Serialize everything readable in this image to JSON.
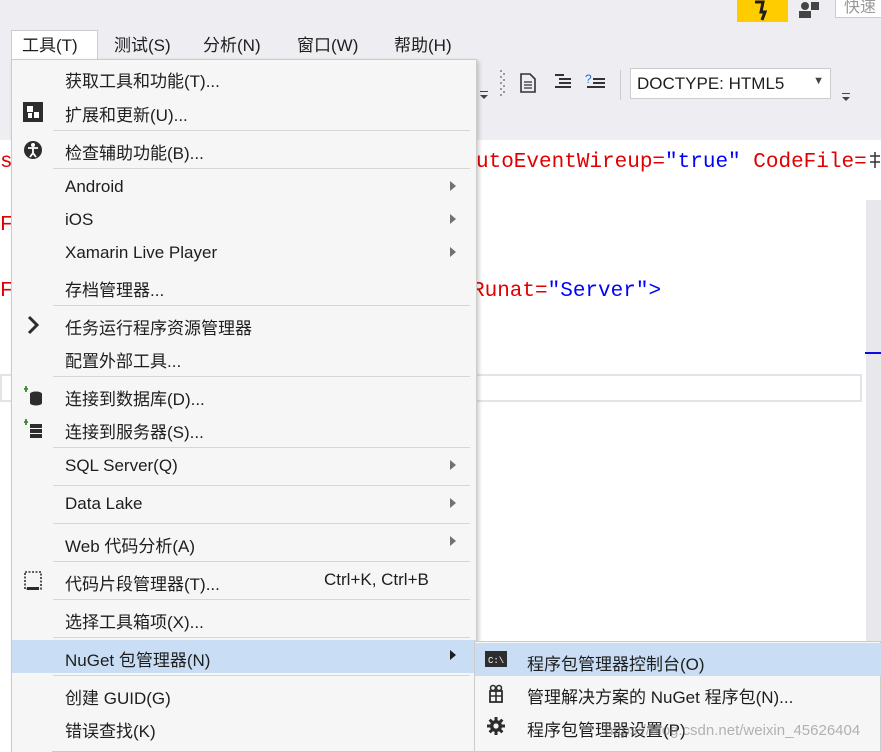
{
  "titlebar": {
    "quick_launch_placeholder": "快速"
  },
  "menubar": {
    "items": [
      {
        "label": "工具(T)"
      },
      {
        "label": "测试(S)"
      },
      {
        "label": "分析(N)"
      },
      {
        "label": "窗口(W)"
      },
      {
        "label": "帮助(H)"
      }
    ]
  },
  "toolbar": {
    "doctype_value": "DOCTYPE: HTML5"
  },
  "editor": {
    "line1_prefix": "s",
    "line1_attr": "utoEventWireup=",
    "line1_val": "\"true\"",
    "line1_attr2": " CodeFile=",
    "line2_prefix": "F",
    "line3_prefix": "F",
    "line3_attr": "Runat=",
    "line3_val": "\"Server\"",
    "line3_end": ">"
  },
  "tools_menu": {
    "items": [
      {
        "label": "获取工具和功能(T)...",
        "icon": "none",
        "submenu": false
      },
      {
        "label": "扩展和更新(U)...",
        "icon": "extensions-icon",
        "submenu": false
      },
      {
        "label": "检查辅助功能(B)...",
        "icon": "accessibility-icon",
        "submenu": false
      },
      {
        "label": "Android",
        "icon": "none",
        "submenu": true
      },
      {
        "label": "iOS",
        "icon": "none",
        "submenu": true
      },
      {
        "label": "Xamarin Live Player",
        "icon": "none",
        "submenu": true
      },
      {
        "label": "存档管理器...",
        "icon": "none",
        "submenu": false
      },
      {
        "label": "任务运行程序资源管理器",
        "icon": "chevron-right-icon",
        "submenu": false
      },
      {
        "label": "配置外部工具...",
        "icon": "none",
        "submenu": false
      },
      {
        "label": "连接到数据库(D)...",
        "icon": "database-connect-icon",
        "submenu": false
      },
      {
        "label": "连接到服务器(S)...",
        "icon": "server-connect-icon",
        "submenu": false
      },
      {
        "label": "SQL Server(Q)",
        "icon": "none",
        "submenu": true
      },
      {
        "label": "Data Lake",
        "icon": "none",
        "submenu": true
      },
      {
        "label": "Web 代码分析(A)",
        "icon": "none",
        "submenu": true
      },
      {
        "label": "代码片段管理器(T)...",
        "icon": "snippet-icon",
        "submenu": false,
        "shortcut": "Ctrl+K, Ctrl+B"
      },
      {
        "label": "选择工具箱项(X)...",
        "icon": "none",
        "submenu": false
      },
      {
        "label": "NuGet 包管理器(N)",
        "icon": "none",
        "submenu": true,
        "highlighted": true
      },
      {
        "label": "创建 GUID(G)",
        "icon": "none",
        "submenu": false
      },
      {
        "label": "错误查找(K)",
        "icon": "none",
        "submenu": false
      }
    ]
  },
  "nuget_submenu": {
    "items": [
      {
        "label": "程序包管理器控制台(O)",
        "icon": "console-icon",
        "highlighted": true
      },
      {
        "label": "管理解决方案的 NuGet 程序包(N)...",
        "icon": "package-icon"
      },
      {
        "label": "程序包管理器设置(P)",
        "icon": "gear-icon"
      }
    ]
  },
  "watermark": "https://blog.csdn.net/weixin_45626404"
}
